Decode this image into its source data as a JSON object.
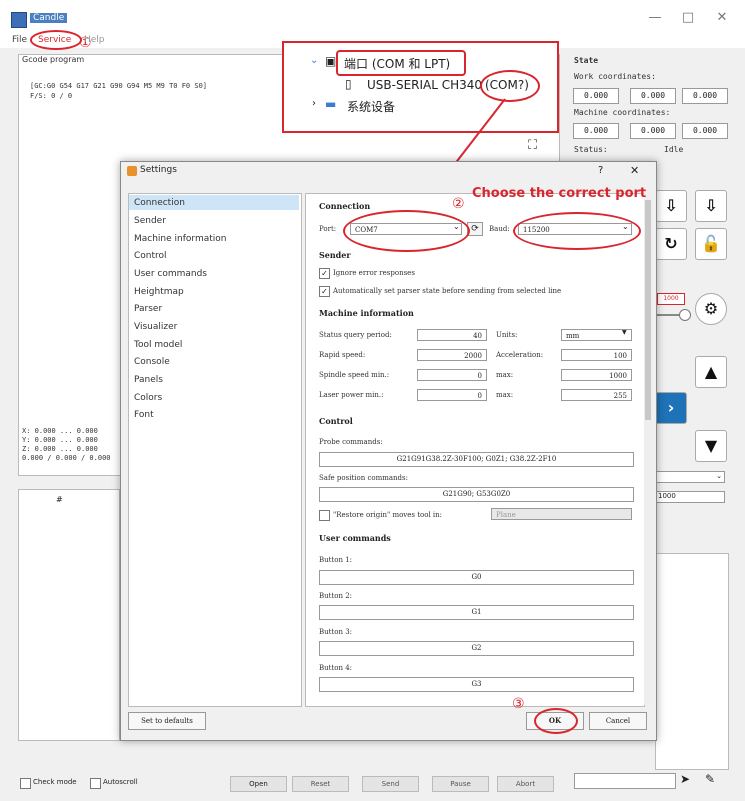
{
  "window": {
    "title": "Candle",
    "minimize": "—",
    "maximize": "□",
    "close": "✕"
  },
  "menu": {
    "file": "File",
    "service": "Service",
    "help": "Help"
  },
  "console": {
    "label": "Gcode program",
    "gcode_line1": "[GC:G0 G54 G17 G21 G90 G94 M5 M9 T0 F0 S0]",
    "gcode_line2": "F/S: 0 / 0",
    "coords_x": "X: 0.000 ... 0.000",
    "coords_y": "Y: 0.000 ... 0.000",
    "coords_z": "Z: 0.000 ... 0.000",
    "coords_w": "0.000 / 0.000 / 0.000",
    "table_header": "#"
  },
  "state": {
    "title": "State",
    "work_label": "Work coordinates:",
    "work": [
      "0.000",
      "0.000",
      "0.000"
    ],
    "machine_label": "Machine coordinates:",
    "machine": [
      "0.000",
      "0.000",
      "0.000"
    ],
    "status_label": "Status:",
    "status_value": "Idle",
    "spindle_value": "1000",
    "speed_value": "1000"
  },
  "popup": {
    "ports": "端口 (COM 和 LPT)",
    "usb": "USB-SERIAL CH340",
    "com": "(COM?)",
    "system": "系统设备"
  },
  "annotations": {
    "step1": "①",
    "step2": "②",
    "step3": "③",
    "hint": "Choose the correct port"
  },
  "settings": {
    "title": "Settings",
    "help": "?",
    "close": "✕",
    "sidebar": [
      "Connection",
      "Sender",
      "Machine information",
      "Control",
      "User commands",
      "Heightmap",
      "Parser",
      "Visualizer",
      "Tool model",
      "Console",
      "Panels",
      "Colors",
      "Font"
    ],
    "connection": "Connection",
    "port_label": "Port:",
    "port_value": "COM7",
    "baud_label": "Baud:",
    "baud_value": "115200",
    "sender": "Sender",
    "ignore": "Ignore error responses",
    "auto_parser": "Automatically set parser state before sending from selected line",
    "machine": "Machine information",
    "status_query": "Status query period:",
    "status_query_v": "40",
    "units": "Units:",
    "units_v": "mm",
    "rapid": "Rapid speed:",
    "rapid_v": "2000",
    "accel": "Acceleration:",
    "accel_v": "100",
    "spindle_min": "Spindle speed min.:",
    "spindle_min_v": "0",
    "spindle_max": "max:",
    "spindle_max_v": "1000",
    "laser_min": "Laser power min.:",
    "laser_min_v": "0",
    "laser_max": "max:",
    "laser_max_v": "255",
    "control": "Control",
    "probe": "Probe commands:",
    "probe_v": "G21G91G38.2Z-30F100; G0Z1; G38.2Z-2F10",
    "safe": "Safe position commands:",
    "safe_v": "G21G90; G53G0Z0",
    "restore": "\"Restore origin\" moves tool in:",
    "restore_v": "Plane",
    "user": "User commands",
    "b1": "Button 1:",
    "b1_v": "G0",
    "b2": "Button 2:",
    "b2_v": "G1",
    "b3": "Button 3:",
    "b3_v": "G2",
    "b4": "Button 4:",
    "b4_v": "G3",
    "defaults": "Set to defaults",
    "ok": "OK",
    "cancel": "Cancel"
  },
  "bottom": {
    "check": "Check mode",
    "autoscroll": "Autoscroll",
    "open": "Open",
    "reset": "Reset",
    "send": "Send",
    "pause": "Pause",
    "abort": "Abort"
  }
}
